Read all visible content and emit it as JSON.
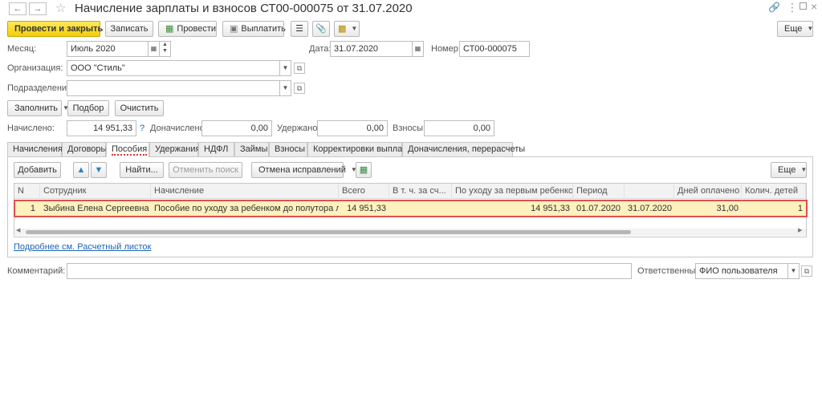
{
  "window": {
    "title": "Начисление зарплаты и взносов СТ00-000075 от 31.07.2020"
  },
  "toolbar": {
    "post_close": "Провести и закрыть",
    "save": "Записать",
    "post": "Провести",
    "pay": "Выплатить",
    "more": "Еще"
  },
  "header": {
    "month_label": "Месяц:",
    "month_value": "Июль 2020",
    "date_label": "Дата:",
    "date_value": "31.07.2020",
    "number_label": "Номер:",
    "number_value": "СТ00-000075",
    "org_label": "Организация:",
    "org_value": "ООО \"Стиль\"",
    "dept_label": "Подразделение:",
    "dept_value": ""
  },
  "actions": {
    "fill": "Заполнить",
    "select": "Подбор",
    "clear": "Очистить"
  },
  "totals": {
    "accrued_label": "Начислено:",
    "accrued_value": "14 951,33",
    "help": "?",
    "extra_label": "Доначислено:",
    "extra_value": "0,00",
    "withheld_label": "Удержано:",
    "withheld_value": "0,00",
    "contrib_label": "Взносы:",
    "contrib_value": "0,00"
  },
  "tabs": [
    "Начисления",
    "Договоры",
    "Пособия",
    "Удержания",
    "НДФЛ",
    "Займы",
    "Взносы",
    "Корректировки выплаты",
    "Доначисления, перерасчеты"
  ],
  "grid_toolbar": {
    "add": "Добавить",
    "find": "Найти...",
    "cancel_search": "Отменить поиск",
    "cancel_fix": "Отмена исправлений",
    "more": "Еще"
  },
  "table": {
    "columns": [
      "N",
      "Сотрудник",
      "Начисление",
      "Всего",
      "В т. ч. за сч...",
      "По уходу за первым ребенком",
      "Период",
      "",
      "Дней оплачено",
      "Колич. детей"
    ],
    "rows": [
      [
        "1",
        "Зыбина Елена Сергеевна",
        "Пособие по уходу за ребенком до полутора лет",
        "14 951,33",
        "",
        "14 951,33",
        "01.07.2020",
        "31.07.2020",
        "31,00",
        "1"
      ]
    ]
  },
  "footer": {
    "link": "Подробнее см. Расчетный листок",
    "comment_label": "Комментарий:",
    "comment_value": "",
    "responsible_label": "Ответственный:",
    "responsible_value": "ФИО пользователя"
  }
}
